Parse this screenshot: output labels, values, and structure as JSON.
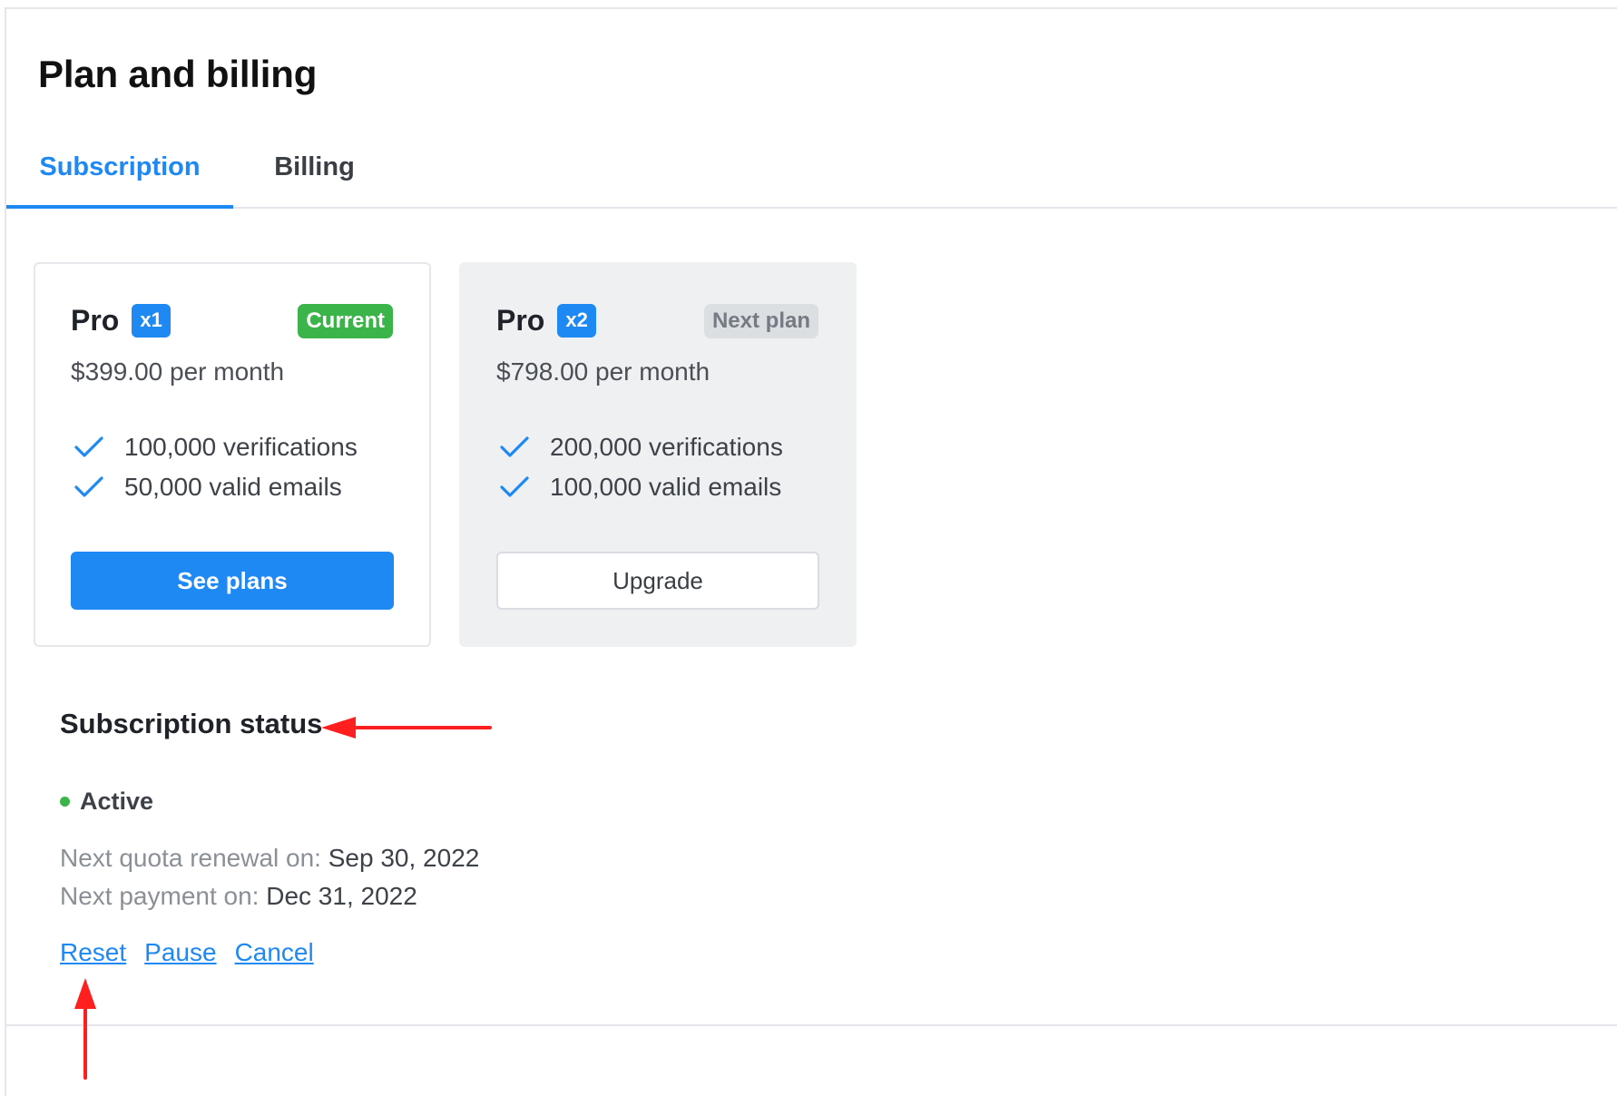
{
  "page": {
    "title": "Plan and billing"
  },
  "tabs": [
    {
      "label": "Subscription",
      "active": true
    },
    {
      "label": "Billing",
      "active": false
    }
  ],
  "plans": [
    {
      "name": "Pro",
      "multiplier": "x1",
      "tag": "Current",
      "price": "$399.00 per month",
      "features": [
        "100,000 verifications",
        "50,000 valid emails"
      ],
      "button": "See plans"
    },
    {
      "name": "Pro",
      "multiplier": "x2",
      "tag": "Next plan",
      "price": "$798.00 per month",
      "features": [
        "200,000 verifications",
        "100,000 valid emails"
      ],
      "button": "Upgrade"
    }
  ],
  "status": {
    "heading": "Subscription status",
    "state": "Active",
    "renewal_label": "Next quota renewal on:",
    "renewal_date": "Sep 30, 2022",
    "payment_label": "Next payment on:",
    "payment_date": "Dec 31, 2022",
    "actions": [
      "Reset",
      "Pause",
      "Cancel"
    ]
  },
  "colors": {
    "accent": "#1e88f3",
    "success": "#3bb54a",
    "annotation_arrow": "#ff1f1f"
  },
  "icons": {
    "feature": "check-icon",
    "status": "status-dot-icon",
    "annotation": "arrow-icon"
  }
}
